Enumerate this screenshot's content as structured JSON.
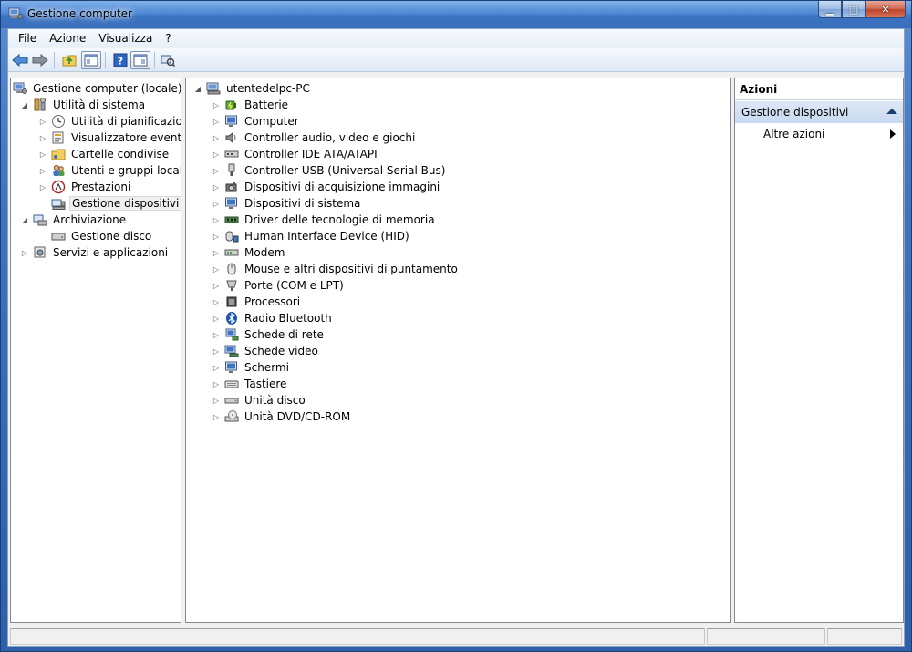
{
  "window": {
    "title": "Gestione computer"
  },
  "window_buttons": {
    "minimize": "▁",
    "maximize": "□",
    "close": "✕"
  },
  "menu": [
    "File",
    "Azione",
    "Visualizza",
    "?"
  ],
  "left_tree": [
    {
      "label": "Gestione computer (locale)",
      "level": 0,
      "expander": "",
      "icon": "computer-management-icon"
    },
    {
      "label": "Utilità di sistema",
      "level": 1,
      "expander": "open",
      "icon": "tools-icon"
    },
    {
      "label": "Utilità di pianificazione",
      "level": 2,
      "expander": "closed",
      "icon": "clock-icon"
    },
    {
      "label": "Visualizzatore eventi",
      "level": 2,
      "expander": "closed",
      "icon": "event-viewer-icon"
    },
    {
      "label": "Cartelle condivise",
      "level": 2,
      "expander": "closed",
      "icon": "shared-folder-icon"
    },
    {
      "label": "Utenti e gruppi locali",
      "level": 2,
      "expander": "closed",
      "icon": "users-icon"
    },
    {
      "label": "Prestazioni",
      "level": 2,
      "expander": "closed",
      "icon": "performance-icon"
    },
    {
      "label": "Gestione dispositivi",
      "level": 2,
      "expander": "",
      "icon": "device-manager-icon",
      "selected": true
    },
    {
      "label": "Archiviazione",
      "level": 1,
      "expander": "open",
      "icon": "storage-icon"
    },
    {
      "label": "Gestione disco",
      "level": 2,
      "expander": "",
      "icon": "disk-management-icon"
    },
    {
      "label": "Servizi e applicazioni",
      "level": 1,
      "expander": "closed",
      "icon": "services-icon"
    }
  ],
  "device_tree": {
    "root": "utentedelpc-PC",
    "categories": [
      {
        "label": "Batterie",
        "icon": "battery-icon"
      },
      {
        "label": "Computer",
        "icon": "computer-icon"
      },
      {
        "label": "Controller audio, video e giochi",
        "icon": "speaker-icon"
      },
      {
        "label": "Controller IDE ATA/ATAPI",
        "icon": "ide-controller-icon"
      },
      {
        "label": "Controller USB (Universal Serial Bus)",
        "icon": "usb-icon"
      },
      {
        "label": "Dispositivi di acquisizione immagini",
        "icon": "camera-icon"
      },
      {
        "label": "Dispositivi di sistema",
        "icon": "system-device-icon"
      },
      {
        "label": "Driver delle tecnologie di memoria",
        "icon": "memory-icon"
      },
      {
        "label": "Human Interface Device (HID)",
        "icon": "hid-icon"
      },
      {
        "label": "Modem",
        "icon": "modem-icon"
      },
      {
        "label": "Mouse e altri dispositivi di puntamento",
        "icon": "mouse-icon"
      },
      {
        "label": "Porte (COM e LPT)",
        "icon": "port-icon"
      },
      {
        "label": "Processori",
        "icon": "processor-icon"
      },
      {
        "label": "Radio Bluetooth",
        "icon": "bluetooth-icon"
      },
      {
        "label": "Schede di rete",
        "icon": "network-adapter-icon"
      },
      {
        "label": "Schede video",
        "icon": "display-adapter-icon"
      },
      {
        "label": "Schermi",
        "icon": "monitor-icon"
      },
      {
        "label": "Tastiere",
        "icon": "keyboard-icon"
      },
      {
        "label": "Unità disco",
        "icon": "disk-drive-icon"
      },
      {
        "label": "Unità DVD/CD-ROM",
        "icon": "dvd-icon"
      }
    ]
  },
  "actions": {
    "header": "Azioni",
    "group": "Gestione dispositivi",
    "item": "Altre azioni"
  },
  "colors": {
    "frame": "#3f74c0",
    "action_group": "#c8d9f0"
  }
}
